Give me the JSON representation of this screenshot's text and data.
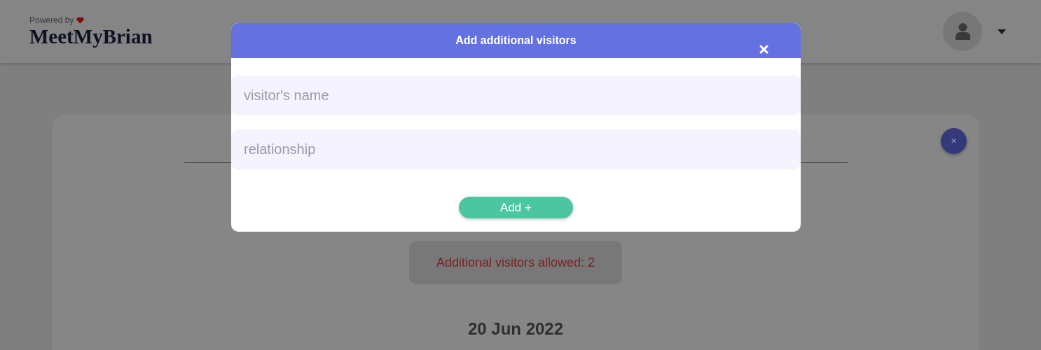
{
  "header": {
    "powered_by": "Powered by",
    "brand": "MeetMyBrian"
  },
  "card": {
    "close_label": "×",
    "notice": "Additional visitors allowed: 2",
    "date": "20 Jun 2022"
  },
  "dialog": {
    "title": "Add additional visitors",
    "fields": [
      {
        "placeholder": "visitor's name"
      },
      {
        "placeholder": "relationship"
      }
    ],
    "button": "Add +"
  }
}
